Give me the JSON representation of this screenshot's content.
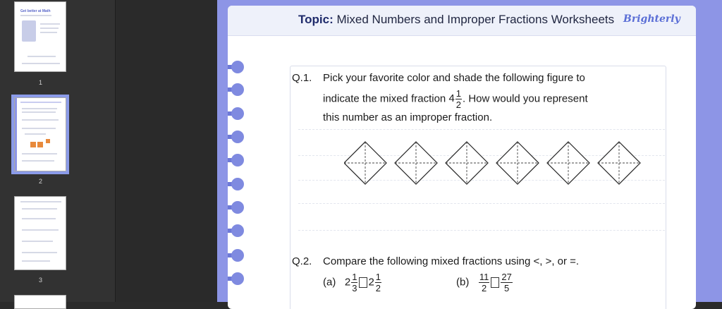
{
  "sidebar": {
    "thumbnails": [
      {
        "page": "1",
        "title": "Get better at Math"
      },
      {
        "page": "2"
      },
      {
        "page": "3"
      }
    ]
  },
  "worksheet": {
    "topic_label": "Topic:",
    "topic_title": "Mixed Numbers and Improper Fractions Worksheets",
    "brand": "Brighterly",
    "q1": {
      "number": "Q.1.",
      "line1": "Pick your favorite color and shade the following figure to",
      "line2_pre": "indicate the mixed fraction",
      "mixed_whole": "4",
      "mixed_num": "1",
      "mixed_den": "2",
      "line2_post": ". How would you represent",
      "line3": "this number as an improper fraction.",
      "figure_count": 6
    },
    "q2": {
      "number": "Q.2.",
      "text": "Compare the following mixed fractions using <, >, or =.",
      "a": {
        "label": "(a)",
        "w1": "2",
        "n1": "1",
        "d1": "3",
        "w2": "2",
        "n2": "1",
        "d2": "2"
      },
      "b": {
        "label": "(b)",
        "n1": "11",
        "d1": "2",
        "n2": "27",
        "d2": "5"
      }
    }
  },
  "colors": {
    "accent": "#8d95e6",
    "title": "#1f2b6b"
  }
}
